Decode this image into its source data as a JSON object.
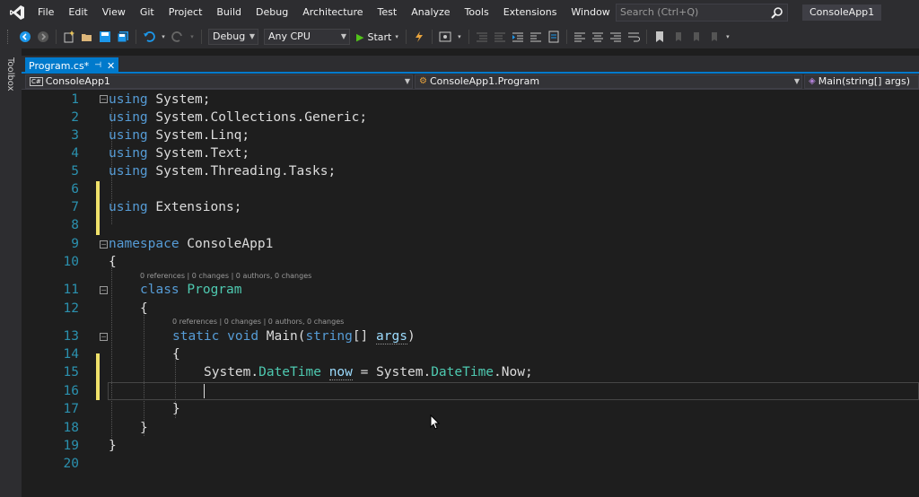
{
  "menu": {
    "items": [
      "File",
      "Edit",
      "View",
      "Git",
      "Project",
      "Build",
      "Debug",
      "Architecture",
      "Test",
      "Analyze",
      "Tools",
      "Extensions",
      "Window",
      "Help"
    ],
    "search_placeholder": "Search (Ctrl+Q)",
    "solution_name": "ConsoleApp1"
  },
  "toolbar": {
    "configuration": "Debug",
    "platform": "Any CPU",
    "start_label": "Start"
  },
  "toolbox": {
    "label": "Toolbox"
  },
  "tab": {
    "title": "Program.cs*"
  },
  "navbar": {
    "project": "ConsoleApp1",
    "type": "ConsoleApp1.Program",
    "member": "Main(string[] args)"
  },
  "codelens": {
    "program": "0 references | 0 changes | 0 authors, 0 changes",
    "main": "0 references | 0 changes | 0 authors, 0 changes"
  },
  "lines": [
    {
      "n": "1"
    },
    {
      "n": "2"
    },
    {
      "n": "3"
    },
    {
      "n": "4"
    },
    {
      "n": "5"
    },
    {
      "n": "6"
    },
    {
      "n": "7"
    },
    {
      "n": "8"
    },
    {
      "n": "9"
    },
    {
      "n": "10"
    },
    {
      "n": "11"
    },
    {
      "n": "12"
    },
    {
      "n": "13"
    },
    {
      "n": "14"
    },
    {
      "n": "15"
    },
    {
      "n": "16"
    },
    {
      "n": "17"
    },
    {
      "n": "18"
    },
    {
      "n": "19"
    },
    {
      "n": "20"
    }
  ],
  "code": {
    "kw_using": "using",
    "kw_namespace": "namespace",
    "kw_class": "class",
    "kw_static": "static",
    "kw_void": "void",
    "kw_string": "string",
    "ns1": " System;",
    "ns2": " System.Collections.Generic;",
    "ns3": " System.Linq;",
    "ns4": " System.Text;",
    "ns5": " System.Threading.Tasks;",
    "ns7": " Extensions;",
    "namespace_name": " ConsoleApp1",
    "open_brace": "{",
    "close_brace": "}",
    "class_name": "Program",
    "method_name": " Main(",
    "brackets": "[] ",
    "param_args": "args",
    "close_paren": ")",
    "sys1": "System.",
    "datetime1": "DateTime",
    "var_now": "now",
    "assign": " = System.",
    "datetime2": "DateTime",
    "now_end": ".Now;"
  },
  "colors": {
    "accent": "#007acc",
    "keyword": "#569cd6",
    "type": "#4ec9b0",
    "line_number": "#2b91af",
    "change_marker": "#efe16a"
  }
}
